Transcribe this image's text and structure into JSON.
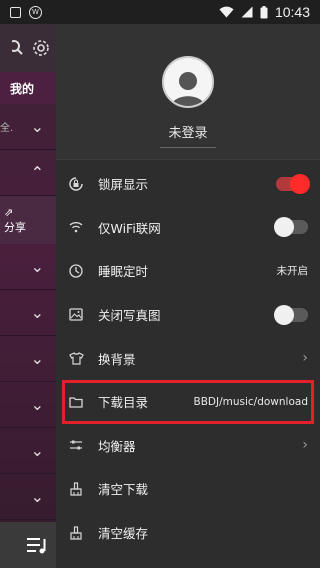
{
  "status_bar": {
    "time": "10:43",
    "logo_text": "W"
  },
  "under_page": {
    "tab_mine": "我的",
    "share_label": "分享"
  },
  "profile": {
    "login_label": "未登录"
  },
  "menu": [
    {
      "label": "锁屏显示",
      "icon": "lock-rotate-icon",
      "control": "toggle",
      "state": "on"
    },
    {
      "label": "仅WiFi联网",
      "icon": "wifi-icon",
      "control": "toggle",
      "state": "off"
    },
    {
      "label": "睡眠定时",
      "icon": "moon-timer-icon",
      "control": "value",
      "value": "未开启"
    },
    {
      "label": "关闭写真图",
      "icon": "image-icon",
      "control": "toggle",
      "state": "off"
    },
    {
      "label": "换背景",
      "icon": "shirt-icon",
      "control": "chevron"
    },
    {
      "label": "下载目录",
      "icon": "folder-icon",
      "control": "value",
      "value": "BBDJ/music/download"
    },
    {
      "label": "均衡器",
      "icon": "equalizer-icon",
      "control": "chevron"
    },
    {
      "label": "清空下载",
      "icon": "broom-icon",
      "control": "none"
    },
    {
      "label": "清空缓存",
      "icon": "broom-icon",
      "control": "none"
    }
  ],
  "colors": {
    "toggle_on": "#ff2a2a",
    "highlight_border": "#e3202b",
    "drawer_bg": "#2d2d2d"
  }
}
